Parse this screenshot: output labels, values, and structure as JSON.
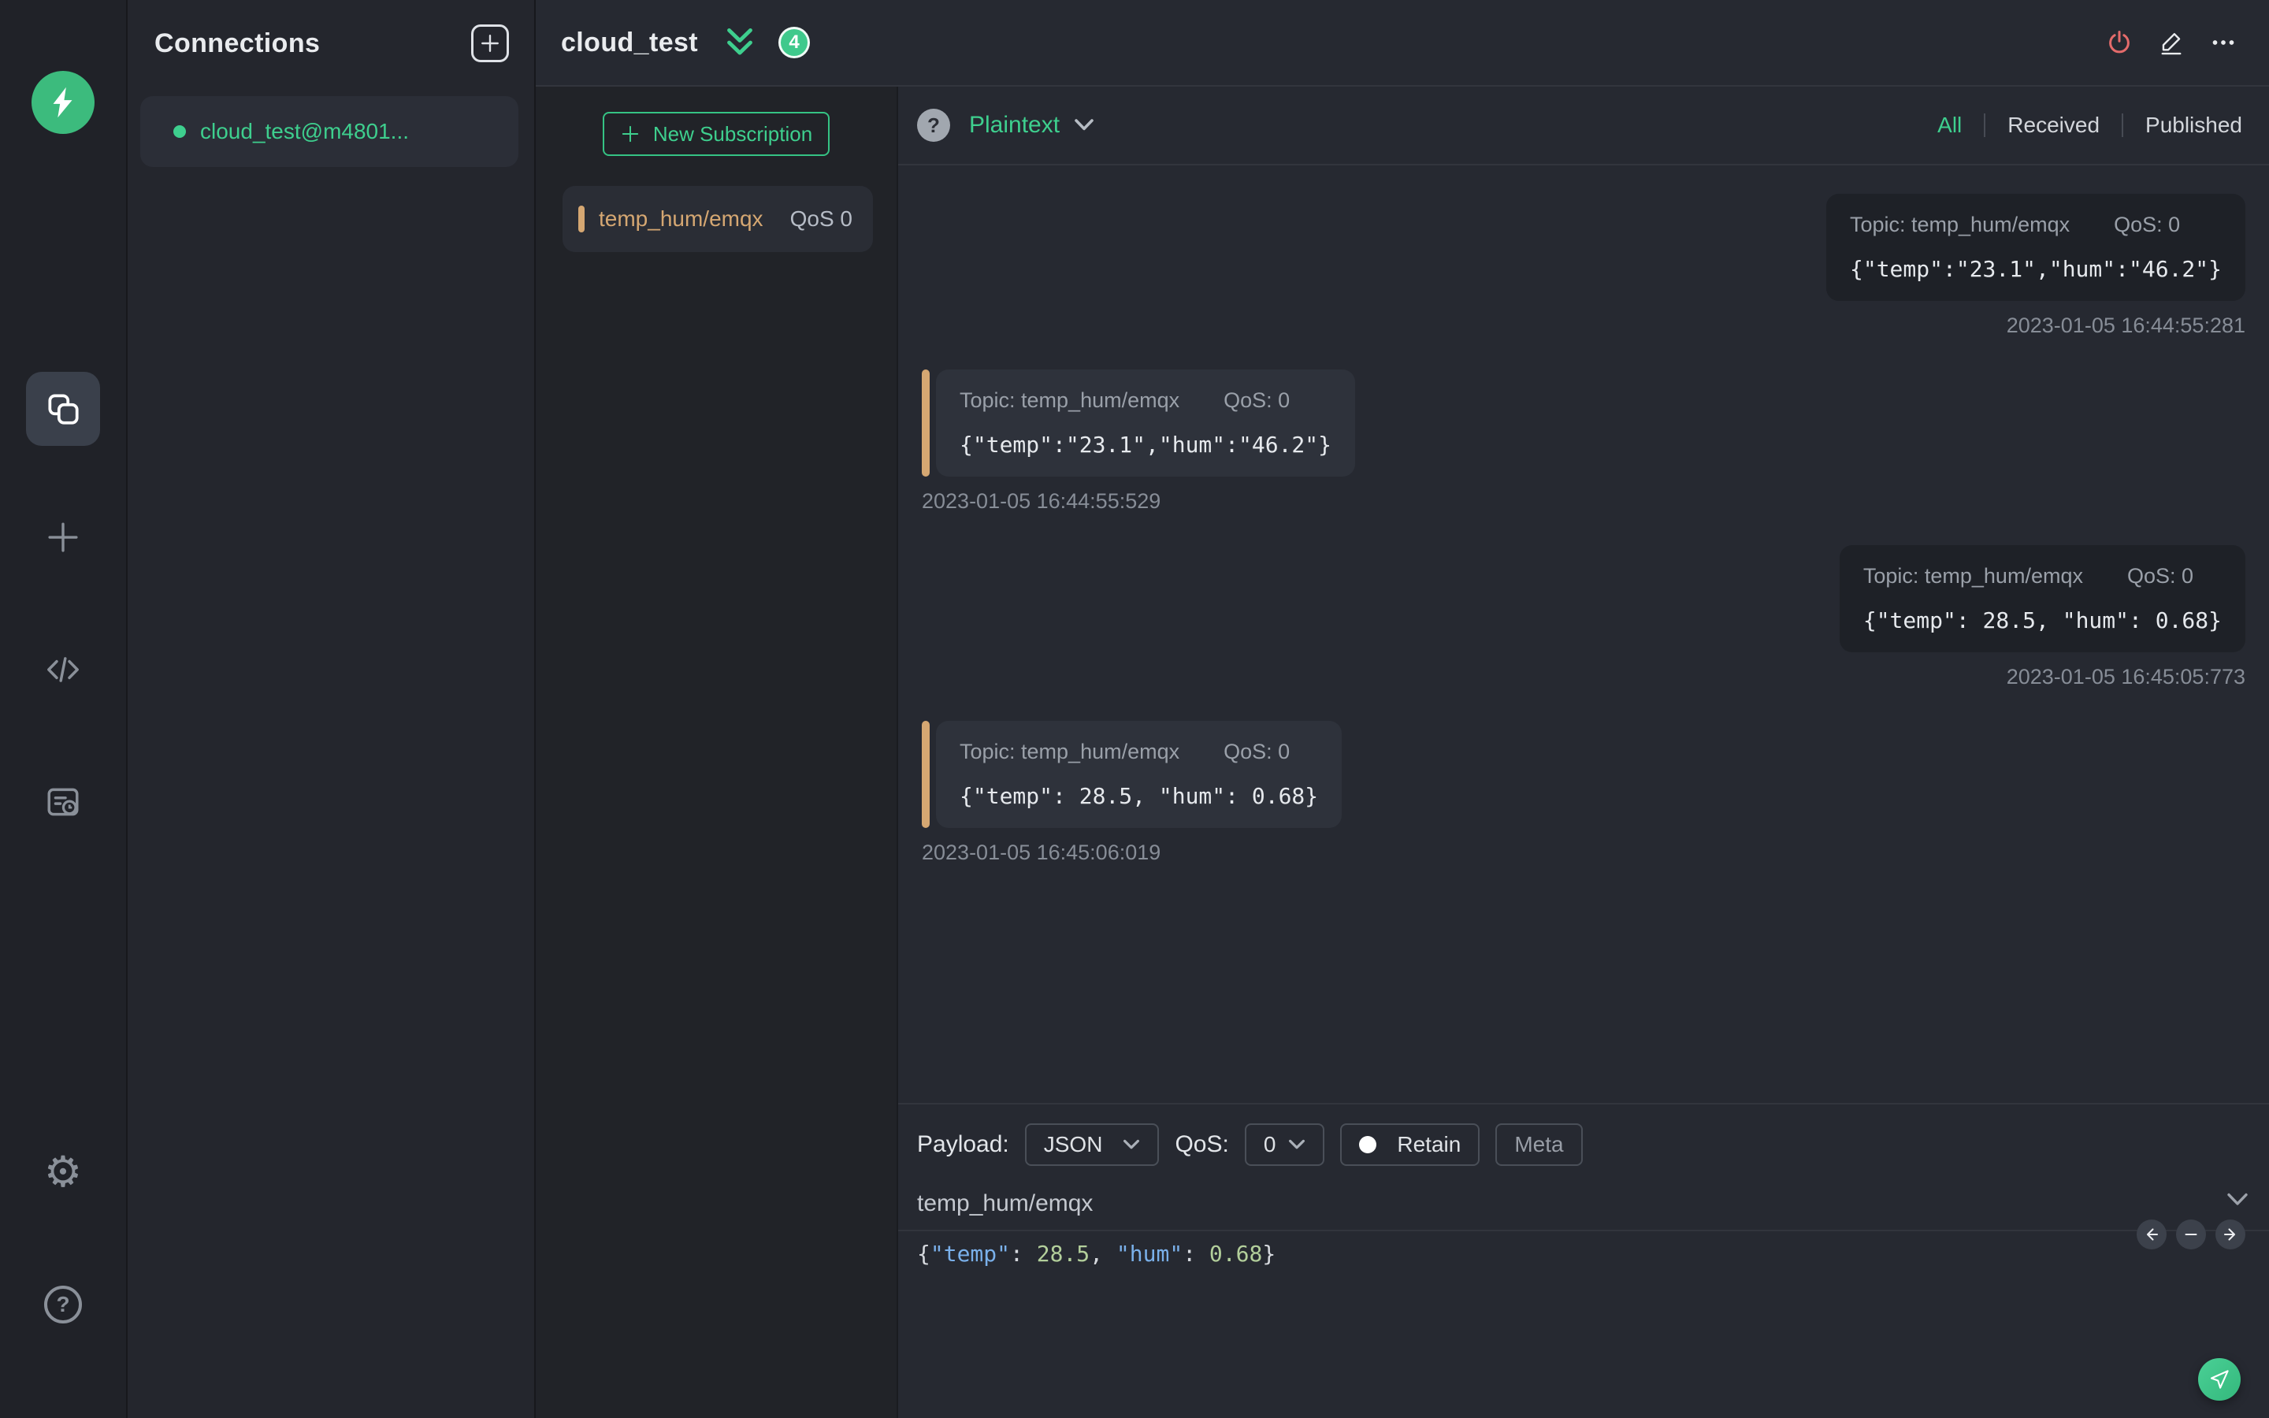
{
  "colors": {
    "accent_green": "#3ecf8e",
    "badge_green": "#3fc98c",
    "topic_tan": "#d5a772",
    "disconnect_red": "#e46b6b",
    "received_card": "#2e323b",
    "published_card": "#1e2127"
  },
  "sidebar": {
    "logo": "mqttx-logo",
    "items": [
      "connections",
      "new-connection",
      "script",
      "log"
    ],
    "footer_items": [
      "settings",
      "help"
    ]
  },
  "connections": {
    "title": "Connections",
    "items": [
      {
        "name": "cloud_test@m4801...",
        "connected": true
      }
    ]
  },
  "topbar": {
    "title": "cloud_test",
    "unread_badge": "4"
  },
  "subscriptions": {
    "new_button_label": "New Subscription",
    "items": [
      {
        "topic": "temp_hum/emqx",
        "qos_label": "QoS 0"
      }
    ]
  },
  "message_toolbar": {
    "format": "Plaintext",
    "filters": [
      "All",
      "Received",
      "Published"
    ],
    "active_filter": "All"
  },
  "messages": [
    {
      "direction": "published",
      "topic_label": "Topic: temp_hum/emqx",
      "qos_label": "QoS: 0",
      "payload": "{\"temp\":\"23.1\",\"hum\":\"46.2\"}",
      "timestamp": "2023-01-05 16:44:55:281"
    },
    {
      "direction": "received",
      "topic_label": "Topic: temp_hum/emqx",
      "qos_label": "QoS: 0",
      "payload": "{\"temp\":\"23.1\",\"hum\":\"46.2\"}",
      "timestamp": "2023-01-05 16:44:55:529"
    },
    {
      "direction": "published",
      "topic_label": "Topic: temp_hum/emqx",
      "qos_label": "QoS: 0",
      "payload": "{\"temp\": 28.5, \"hum\": 0.68}",
      "timestamp": "2023-01-05 16:45:05:773"
    },
    {
      "direction": "received",
      "topic_label": "Topic: temp_hum/emqx",
      "qos_label": "QoS: 0",
      "payload": "{\"temp\": 28.5, \"hum\": 0.68}",
      "timestamp": "2023-01-05 16:45:06:019"
    }
  ],
  "publish": {
    "payload_label": "Payload:",
    "payload_format": "JSON",
    "qos_label": "QoS:",
    "qos_value": "0",
    "retain_label": "Retain",
    "meta_label": "Meta",
    "topic": "temp_hum/emqx",
    "payload": "{\"temp\": 28.5, \"hum\": 0.68}"
  }
}
